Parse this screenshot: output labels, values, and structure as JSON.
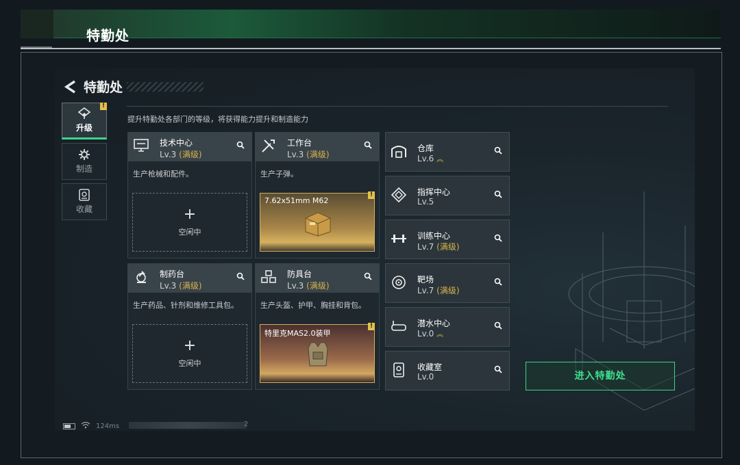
{
  "window": {
    "title": "特勤处"
  },
  "page": {
    "title": "特勤处",
    "description": "提升特勤处各部门的等级，将获得能力提升和制造能力"
  },
  "tabs": [
    {
      "label": "升级",
      "icon": "upgrade-icon",
      "active": true,
      "badge": "!"
    },
    {
      "label": "制造",
      "icon": "gear-icon",
      "active": false
    },
    {
      "label": "收藏",
      "icon": "collection-icon",
      "active": false
    }
  ],
  "departments_large": [
    {
      "name": "技术中心",
      "level": "Lv.3",
      "max": "(满级)",
      "icon": "tech-center-icon",
      "desc": "生产枪械和配件。",
      "slot": {
        "type": "empty",
        "plus": "+",
        "text": "空闲中"
      }
    },
    {
      "name": "工作台",
      "level": "Lv.3",
      "max": "(满级)",
      "icon": "workbench-icon",
      "desc": "生产子弹。",
      "slot": {
        "type": "item",
        "name": "7.62x51mm M62",
        "badge": "!"
      }
    },
    {
      "name": "制药台",
      "level": "Lv.3",
      "max": "(满级)",
      "icon": "pharmacy-icon",
      "desc": "生产药品、针剂和维修工具包。",
      "slot": {
        "type": "empty",
        "plus": "+",
        "text": "空闲中"
      }
    },
    {
      "name": "防具台",
      "level": "Lv.3",
      "max": "(满级)",
      "icon": "armor-bench-icon",
      "desc": "生产头盔、护甲、胸挂和背包。",
      "slot": {
        "type": "item",
        "name": "特里克MAS2.0装甲",
        "badge": "!"
      }
    }
  ],
  "departments_small": [
    {
      "name": "仓库",
      "level": "Lv.6",
      "max": "",
      "upgrade": true,
      "icon": "warehouse-icon"
    },
    {
      "name": "指挥中心",
      "level": "Lv.5",
      "max": "",
      "upgrade": false,
      "icon": "command-center-icon"
    },
    {
      "name": "训练中心",
      "level": "Lv.7",
      "max": "(满级)",
      "upgrade": false,
      "icon": "dumbbell-icon"
    },
    {
      "name": "靶场",
      "level": "Lv.7",
      "max": "(满级)",
      "upgrade": false,
      "icon": "target-icon"
    },
    {
      "name": "潜水中心",
      "level": "Lv.0",
      "max": "",
      "upgrade": true,
      "icon": "diving-mask-icon"
    },
    {
      "name": "收藏室",
      "level": "Lv.0",
      "max": "",
      "upgrade": false,
      "icon": "collection-room-icon"
    }
  ],
  "enter_button": {
    "label": "进入特勤处"
  },
  "status": {
    "ping": "124ms",
    "fragment": "2"
  },
  "colors": {
    "accent": "#3cd58b",
    "max_level": "#d8b24c",
    "badge": "#e3c14a"
  }
}
